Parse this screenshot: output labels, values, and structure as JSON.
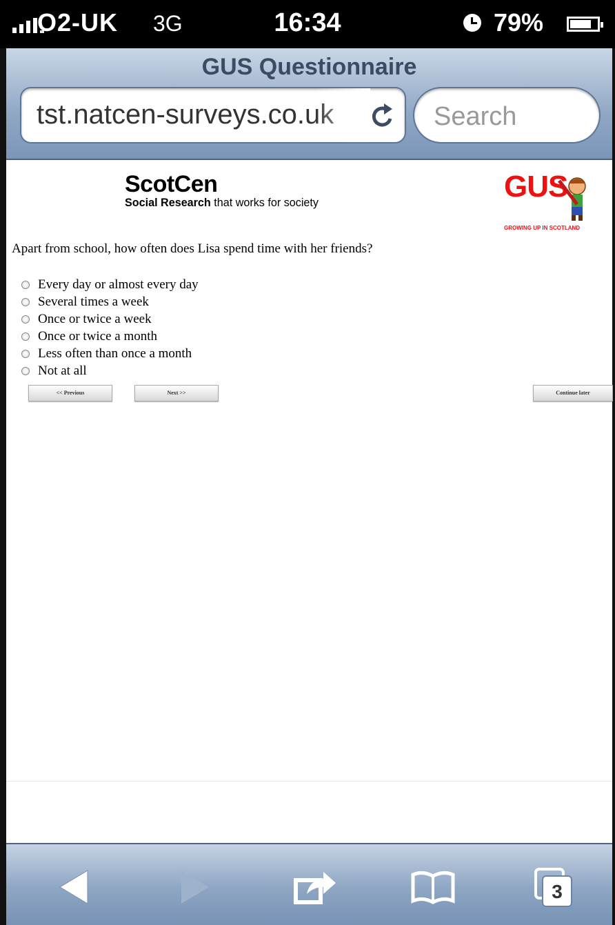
{
  "status_bar": {
    "carrier": "O2-UK",
    "network": "3G",
    "time": "16:34",
    "battery_percent": "79%",
    "battery_level": 0.79
  },
  "browser": {
    "title": "GUS Questionnaire",
    "url": "tst.natcen-surveys.co.uk",
    "search_placeholder": "Search",
    "tabs_count": "3"
  },
  "page": {
    "logo_left": {
      "name": "ScotCen",
      "tagline_bold": "Social Research",
      "tagline_rest": " that works for society"
    },
    "logo_right": {
      "name": "GUS",
      "subtitle": "GROWING UP IN SCOTLAND"
    },
    "question": "Apart from school, how often does Lisa spend time with her friends?",
    "options": [
      "Every day or almost every day",
      "Several times a week",
      "Once or twice a week",
      "Once or twice a month",
      "Less often than once a month",
      "Not at all"
    ],
    "buttons": {
      "previous": "<< Previous",
      "next": "Next >>",
      "continue_later": "Continue later"
    }
  },
  "colors": {
    "chrome_blue": "#8fa7c4",
    "logo_red": "#e11"
  }
}
